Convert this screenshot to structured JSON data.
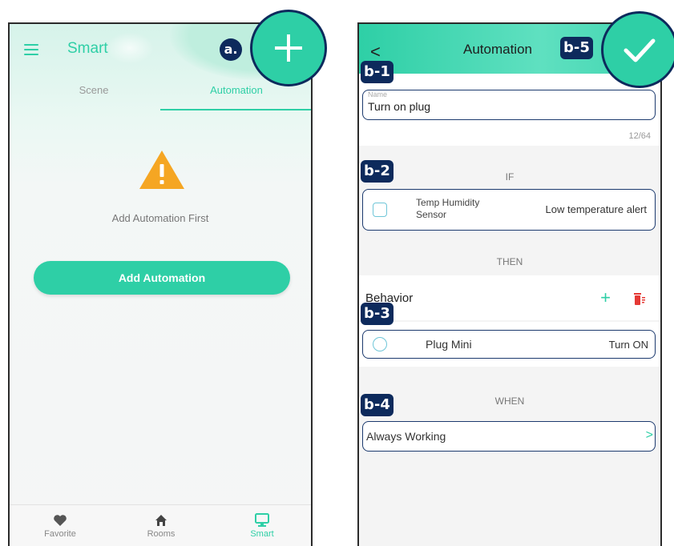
{
  "left": {
    "app_title": "Smart",
    "tabs": [
      "Scene",
      "Automation"
    ],
    "empty_message": "Add Automation First",
    "add_button": "Add Automation",
    "nav": [
      "Favorite",
      "Rooms",
      "Smart"
    ]
  },
  "right": {
    "title": "Automation",
    "back": "<",
    "name_label": "Name",
    "name_value": "Turn on plug",
    "name_counter": "12/64",
    "if_label": "IF",
    "if_device": "Temp Humidity Sensor",
    "if_condition": "Low temperature alert",
    "then_label": "THEN",
    "behavior_label": "Behavior",
    "behavior_add": "+",
    "then_device": "Plug Mini",
    "then_action": "Turn ON",
    "when_label": "WHEN",
    "when_value": "Always Working",
    "when_chevron": ">"
  },
  "annotations": {
    "a": "a.",
    "b1": "b-1",
    "b2": "b-2",
    "b3": "b-3",
    "b4": "b-4",
    "b5": "b-5"
  },
  "icons": {
    "add": "plus-icon",
    "confirm": "check-icon",
    "menu": "hamburger-icon",
    "warning": "warning-icon",
    "favorite": "heart-icon",
    "rooms": "home-icon",
    "smart": "monitor-icon",
    "sensor": "sensor-icon",
    "plug": "plug-icon",
    "delete": "trash-icon"
  },
  "colors": {
    "accent": "#2ecfa6",
    "annotation": "#0d2a5c",
    "warning": "#f5a623",
    "delete": "#e53935"
  }
}
